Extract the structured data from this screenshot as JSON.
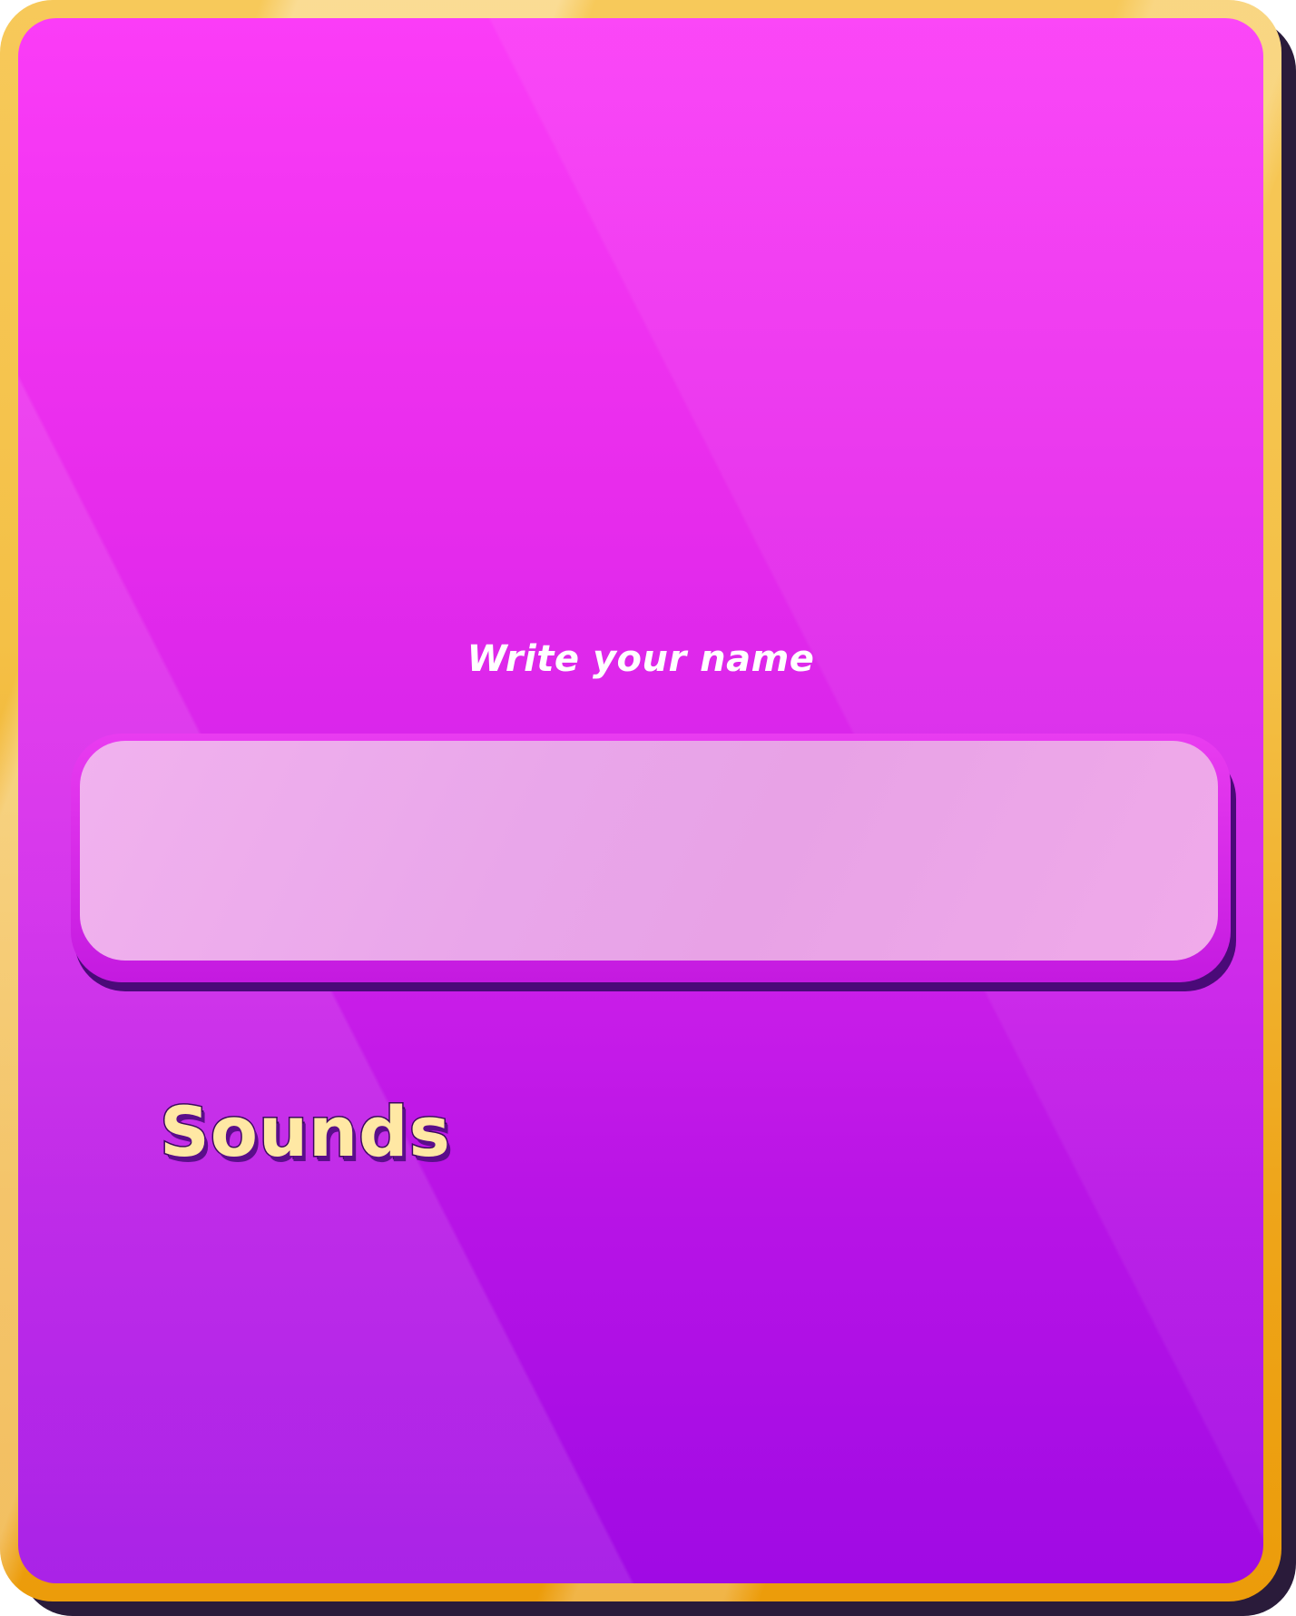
{
  "settings_panel": {
    "name_prompt": "Write your name",
    "name_input_value": "",
    "sounds_label": "Sounds"
  },
  "colors": {
    "frame": "#f4c046",
    "panel_top": "#fb3cf7",
    "panel_bottom": "#a00ae4",
    "input_fill": "#eaa6e8",
    "label_text": "#ffffff",
    "heading_text": "#ffe8a4"
  }
}
